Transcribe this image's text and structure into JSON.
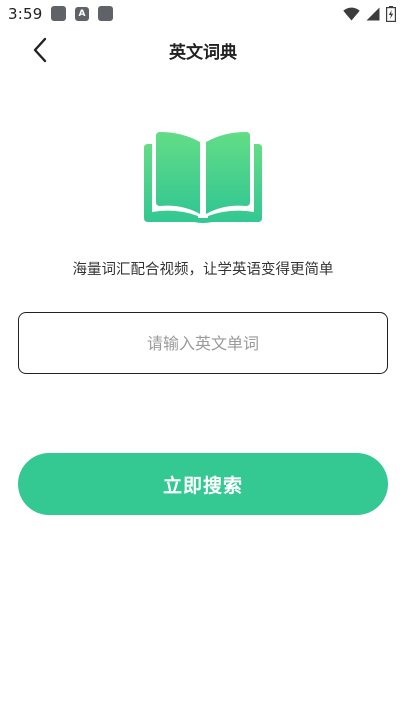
{
  "status_bar": {
    "time": "3:59",
    "icons": [
      "app-icon",
      "a-icon",
      "app-icon",
      "wifi-icon",
      "signal-icon",
      "battery-icon"
    ],
    "small_icon_letter": "A"
  },
  "header": {
    "title": "英文词典",
    "back_icon": "chevron-left-icon"
  },
  "main": {
    "illustration_icon": "open-book-icon",
    "tagline": "海量词汇配合视频，让学英语变得更简单",
    "search": {
      "value": "",
      "placeholder": "请输入英文单词"
    },
    "search_button_label": "立即搜索"
  },
  "colors": {
    "accent": "#34c892",
    "book_gradient_top": "#5fdc86",
    "book_gradient_bottom": "#34c892",
    "text_primary": "#222222",
    "placeholder": "#9a9a9a"
  }
}
